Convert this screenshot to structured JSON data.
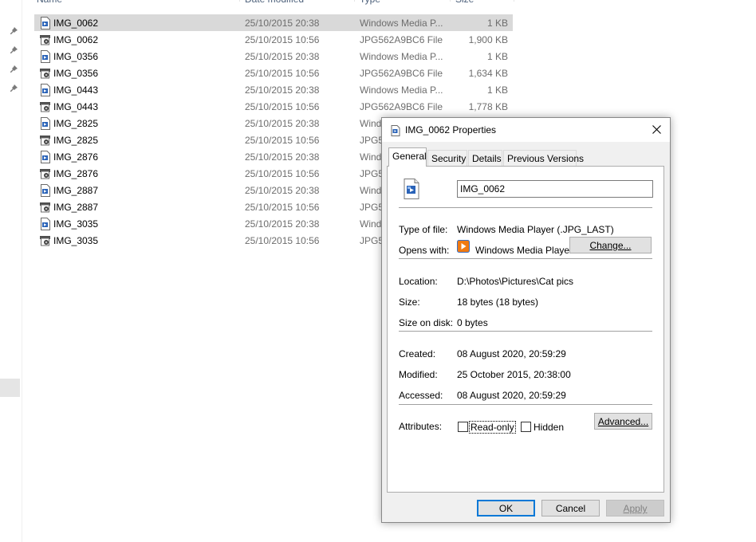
{
  "explorer": {
    "columns": {
      "name": "Name",
      "date": "Date modified",
      "type": "Type",
      "size": "Size"
    },
    "files": [
      {
        "name": "IMG_0062",
        "date": "25/10/2015 20:38",
        "type": "Windows Media P...",
        "size": "1 KB",
        "icon": "media-player-file-icon",
        "selected": true
      },
      {
        "name": "IMG_0062",
        "date": "25/10/2015 10:56",
        "type": "JPG562A9BC6 File",
        "size": "1,900 KB",
        "icon": "image-file-icon",
        "selected": false
      },
      {
        "name": "IMG_0356",
        "date": "25/10/2015 20:38",
        "type": "Windows Media P...",
        "size": "1 KB",
        "icon": "media-player-file-icon",
        "selected": false
      },
      {
        "name": "IMG_0356",
        "date": "25/10/2015 10:56",
        "type": "JPG562A9BC6 File",
        "size": "1,634 KB",
        "icon": "image-file-icon",
        "selected": false
      },
      {
        "name": "IMG_0443",
        "date": "25/10/2015 20:38",
        "type": "Windows Media P...",
        "size": "1 KB",
        "icon": "media-player-file-icon",
        "selected": false
      },
      {
        "name": "IMG_0443",
        "date": "25/10/2015 10:56",
        "type": "JPG562A9BC6 File",
        "size": "1,778 KB",
        "icon": "image-file-icon",
        "selected": false
      },
      {
        "name": "IMG_2825",
        "date": "25/10/2015 20:38",
        "type": "Wind",
        "size": "",
        "icon": "media-player-file-icon",
        "selected": false
      },
      {
        "name": "IMG_2825",
        "date": "25/10/2015 10:56",
        "type": "JPG5",
        "size": "",
        "icon": "image-file-icon",
        "selected": false
      },
      {
        "name": "IMG_2876",
        "date": "25/10/2015 20:38",
        "type": "Wind",
        "size": "",
        "icon": "media-player-file-icon",
        "selected": false
      },
      {
        "name": "IMG_2876",
        "date": "25/10/2015 10:56",
        "type": "JPG5",
        "size": "",
        "icon": "image-file-icon",
        "selected": false
      },
      {
        "name": "IMG_2887",
        "date": "25/10/2015 20:38",
        "type": "Wind",
        "size": "",
        "icon": "media-player-file-icon",
        "selected": false
      },
      {
        "name": "IMG_2887",
        "date": "25/10/2015 10:56",
        "type": "JPG5",
        "size": "",
        "icon": "image-file-icon",
        "selected": false
      },
      {
        "name": "IMG_3035",
        "date": "25/10/2015 20:38",
        "type": "Wind",
        "size": "",
        "icon": "media-player-file-icon",
        "selected": false
      },
      {
        "name": "IMG_3035",
        "date": "25/10/2015 10:56",
        "type": "JPG5",
        "size": "",
        "icon": "image-file-icon",
        "selected": false
      }
    ]
  },
  "dialog": {
    "title": "IMG_0062 Properties",
    "tabs": [
      "General",
      "Security",
      "Details",
      "Previous Versions"
    ],
    "active_tab": "General",
    "file_name": "IMG_0062",
    "type_label": "Type of file:",
    "type_value": "Windows Media Player (.JPG_LAST)",
    "opens_label": "Opens with:",
    "opens_value": "Windows Media Player",
    "change_button": "Change...",
    "location_label": "Location:",
    "location_value": "D:\\Photos\\Pictures\\Cat pics",
    "size_label": "Size:",
    "size_value": "18 bytes (18 bytes)",
    "size_on_disk_label": "Size on disk:",
    "size_on_disk_value": "0 bytes",
    "created_label": "Created:",
    "created_value": "08 August 2020, 20:59:29",
    "modified_label": "Modified:",
    "modified_value": "25 October 2015, 20:38:00",
    "accessed_label": "Accessed:",
    "accessed_value": "08 August 2020, 20:59:29",
    "attributes_label": "Attributes:",
    "readonly_label": "Read-only",
    "readonly_checked": false,
    "hidden_label": "Hidden",
    "hidden_checked": false,
    "advanced_button": "Advanced...",
    "ok_button": "OK",
    "cancel_button": "Cancel",
    "apply_button": "Apply"
  },
  "colors": {
    "selection": "#d9d9d9",
    "dialog_bg": "#f0f0f0",
    "default_button_border": "#0078d7",
    "muted_text": "#6d6d6d"
  }
}
